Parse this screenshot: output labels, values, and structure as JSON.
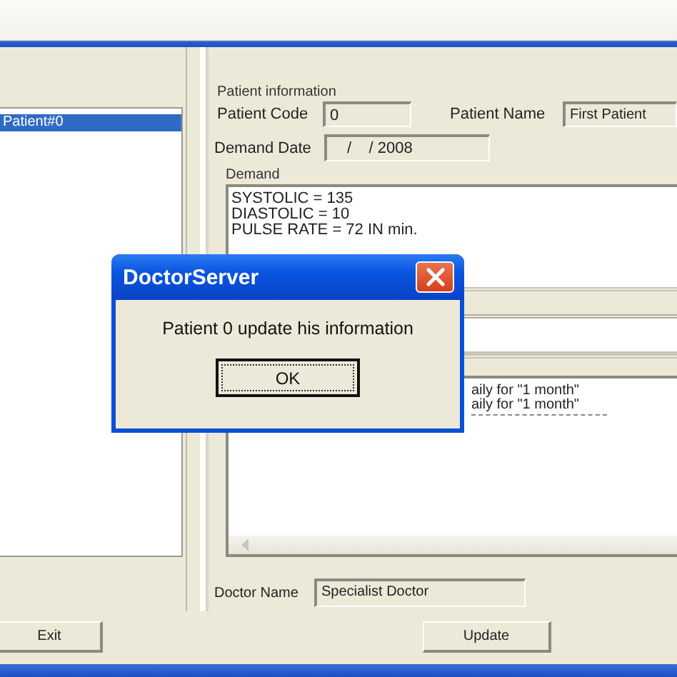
{
  "list": {
    "items": [
      {
        "label": "Patient#0",
        "selected": true
      }
    ]
  },
  "patient_information": {
    "title": "Patient information",
    "fields": [
      {
        "label": "Patient Code",
        "value": "0"
      },
      {
        "label": "Patient Name",
        "value": "First Patient"
      },
      {
        "label": "Demand Date",
        "value": "/    / 2008"
      }
    ]
  },
  "demand": {
    "title": "Demand",
    "lines": [
      "SYSTOLIC = 135",
      "DIASTOLIC = 10",
      "PULSE RATE = 72  IN min."
    ]
  },
  "notes": {
    "lines": [
      "aily for \"1 month\"",
      "aily for \"1 month\""
    ]
  },
  "doctor": {
    "label": "Doctor Name",
    "value": "Specialist Doctor"
  },
  "buttons": [
    {
      "label": "Exit"
    },
    {
      "label": "Update"
    }
  ],
  "dialog": {
    "title": "DoctorServer",
    "message": "Patient 0 update his information",
    "button": "OK"
  }
}
